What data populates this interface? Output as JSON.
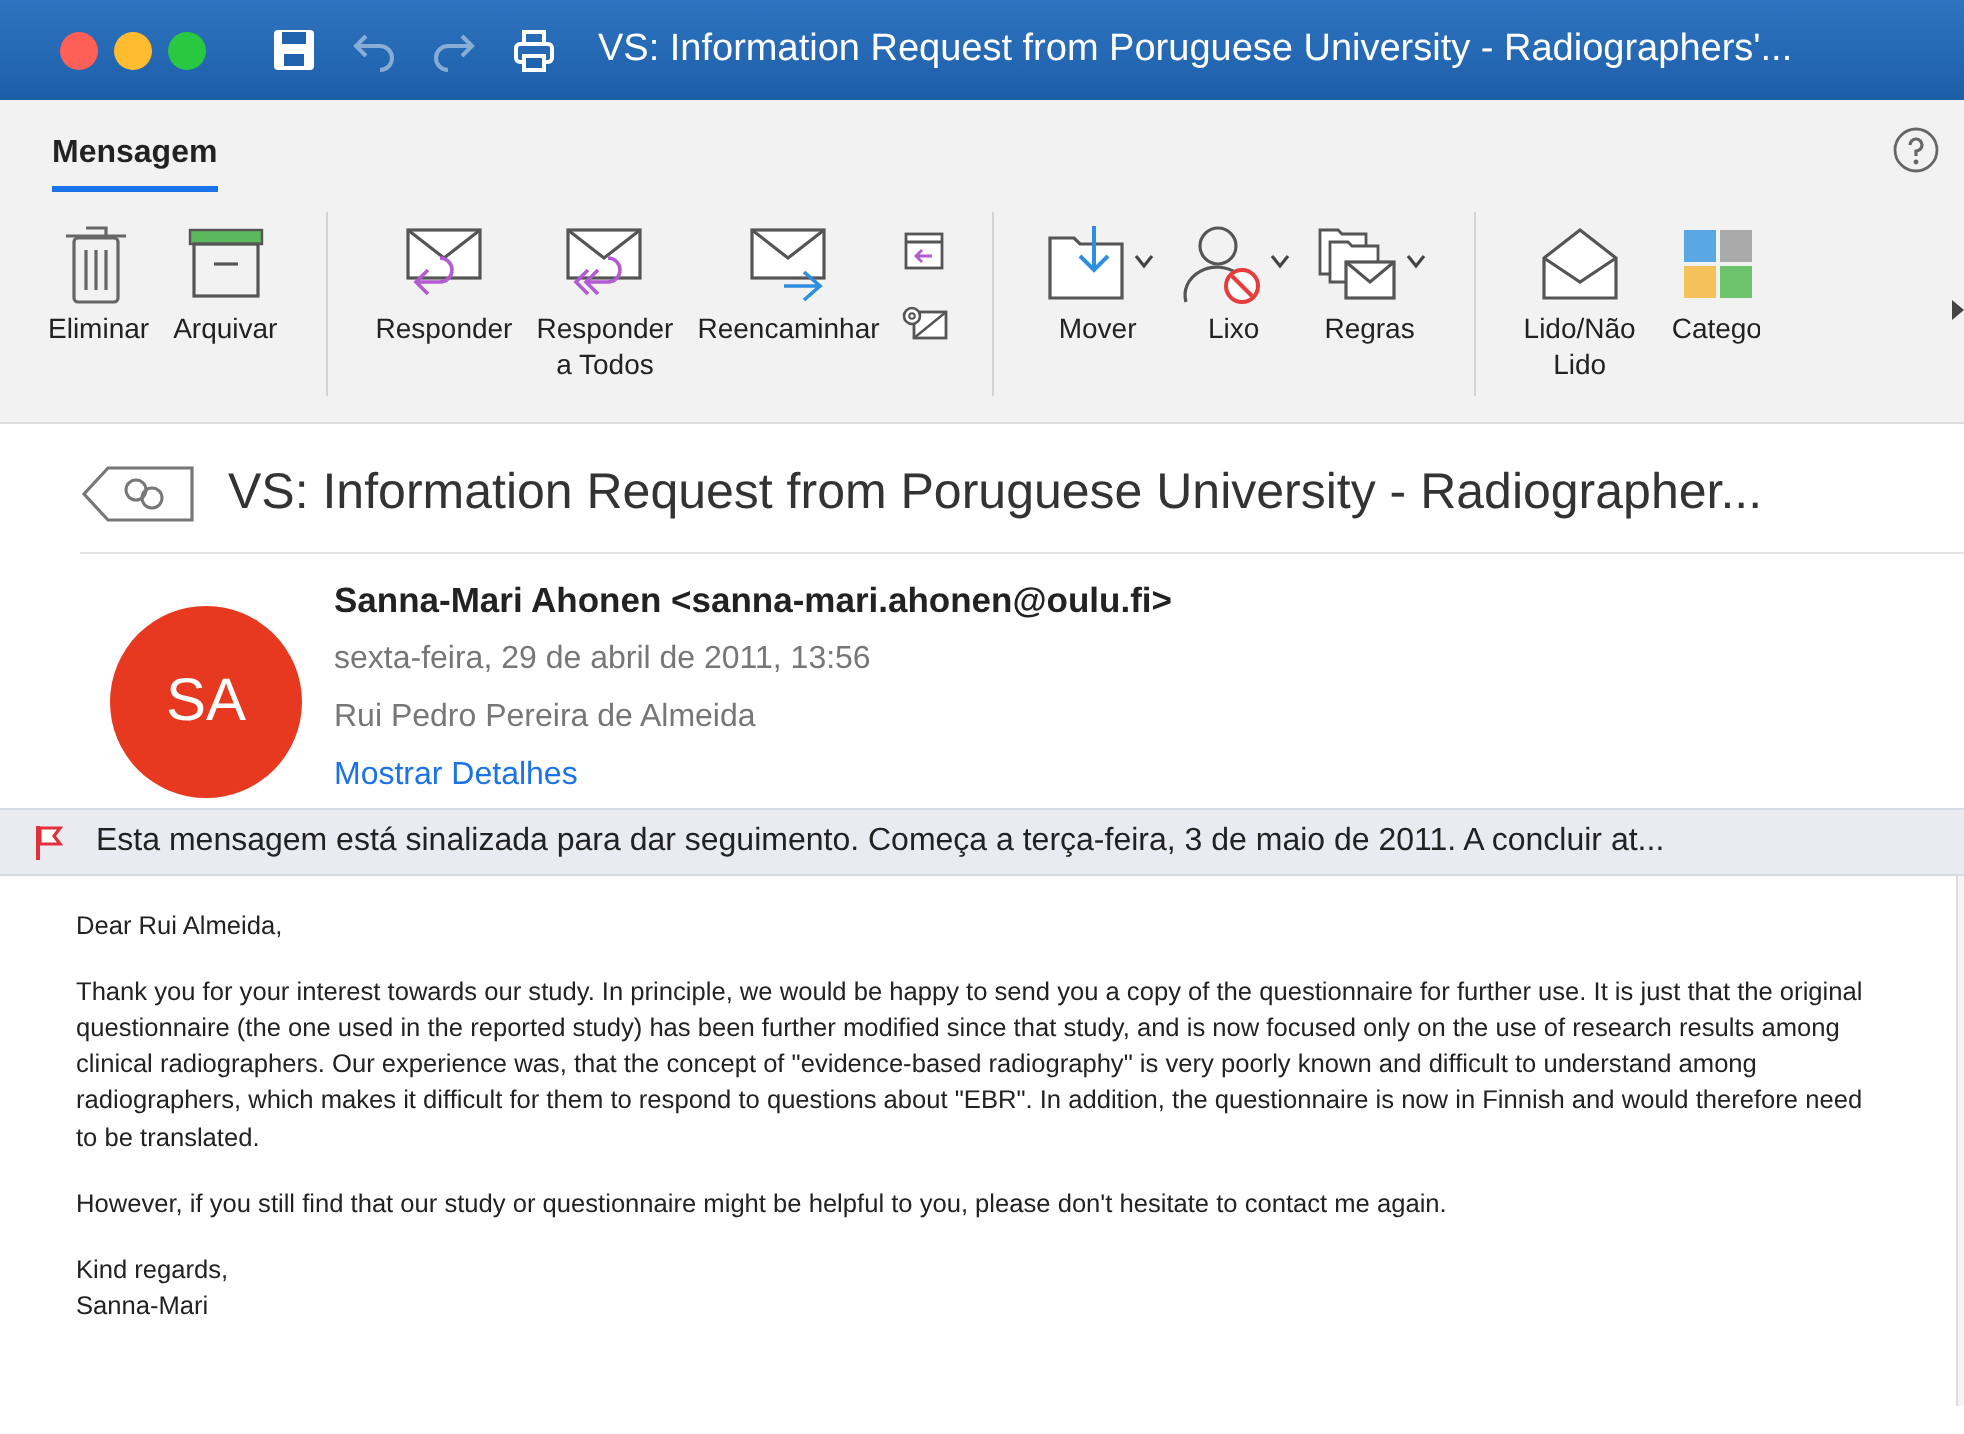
{
  "window": {
    "title": "VS: Information Request from Poruguese University - Radiographers'..."
  },
  "quick_access": [
    {
      "disabled": false
    },
    {
      "disabled": true
    },
    {
      "disabled": true
    },
    {
      "disabled": false
    }
  ],
  "ribbon_tabs": [
    {
      "label": "Mensagem",
      "selected": true
    }
  ],
  "ribbon_groups": [
    {
      "items": [
        {
          "kind": "large",
          "label": "Eliminar",
          "dropdown": false
        },
        {
          "kind": "large",
          "label": "Arquivar",
          "dropdown": false
        }
      ]
    },
    {
      "items": [
        {
          "kind": "large",
          "label": "Responder",
          "dropdown": false
        },
        {
          "kind": "large",
          "label": "Responder\na Todos",
          "dropdown": false
        },
        {
          "kind": "large",
          "label": "Reencaminhar",
          "dropdown": false
        },
        {
          "kind": "small"
        }
      ]
    },
    {
      "items": [
        {
          "kind": "large",
          "label": "Mover",
          "dropdown": true
        },
        {
          "kind": "large",
          "label": "Lixo",
          "dropdown": true
        },
        {
          "kind": "large",
          "label": "Regras",
          "dropdown": true
        }
      ]
    },
    {
      "items": [
        {
          "kind": "large",
          "label": "Lido/Não\nLido",
          "dropdown": false
        },
        {
          "kind": "large",
          "label": "Catego",
          "dropdown": false
        }
      ]
    }
  ],
  "message": {
    "subject": "VS: Information Request from Poruguese University - Radiographer...",
    "avatar": "SA",
    "sender": "Sanna-Mari Ahonen <sanna-mari.ahonen@oulu.fi>",
    "date": "sexta-feira, 29 de abril de 2011, 13:56",
    "recipient": "Rui Pedro Pereira de Almeida",
    "details_link": "Mostrar Detalhes",
    "flag_notice": "Esta mensagem está sinalizada para dar seguimento. Começa a terça-feira, 3 de maio de 2011. A concluir at...",
    "body": [
      "Dear Rui Almeida,",
      "Thank you for your interest towards our study. In principle, we would be happy to send you a copy of the questionnaire for further use. It is just that the original questionnaire (the one used in the reported study) has been further modified since that study, and is now focused only on the use of research results among clinical radiographers. Our experience was, that the concept of \"evidence-based radiography\" is very poorly known and difficult to understand among radiographers, which makes it difficult for them to respond to questions about \"EBR\". In addition, the questionnaire is now in Finnish and would therefore need to be translated.",
      "However, if you still find that our study or questionnaire might be helpful to you, please don't hesitate to contact me again.",
      "Kind regards,\nSanna-Mari"
    ]
  }
}
